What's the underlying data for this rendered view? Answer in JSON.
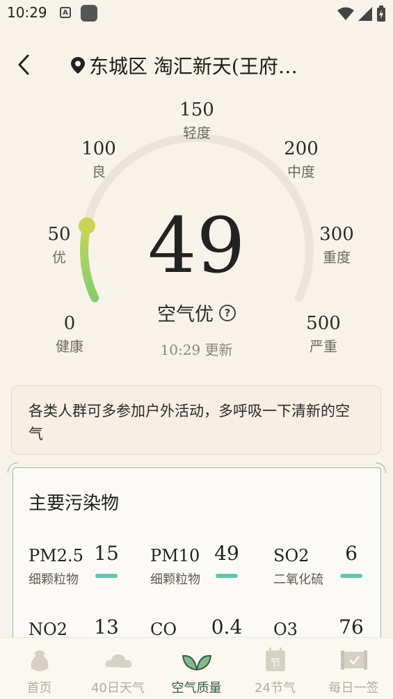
{
  "status_bar": {
    "time": "10:29",
    "notif_a": "A"
  },
  "header": {
    "location": "东城区 淘汇新天(王府…"
  },
  "gauge": {
    "value": 49,
    "value_text": "49",
    "level": "空气优",
    "help": "?",
    "update": "10:29 更新",
    "max": 500,
    "ticks": [
      {
        "num": "0",
        "label": "健康"
      },
      {
        "num": "50",
        "label": "优"
      },
      {
        "num": "100",
        "label": "良"
      },
      {
        "num": "150",
        "label": "轻度"
      },
      {
        "num": "200",
        "label": "中度"
      },
      {
        "num": "300",
        "label": "重度"
      },
      {
        "num": "500",
        "label": "严重"
      }
    ],
    "colors": {
      "track": "#e9e5da",
      "start": "#86cd6a",
      "end": "#c6d45a"
    }
  },
  "advice": {
    "text": "各类人群可多参加户外活动，多呼吸一下清新的空气"
  },
  "pollutants": {
    "title": "主要污染物",
    "items": [
      {
        "name": "PM2.5",
        "desc": "细颗粒物",
        "value": "15"
      },
      {
        "name": "PM10",
        "desc": "细颗粒物",
        "value": "49"
      },
      {
        "name": "SO2",
        "desc": "二氧化硫",
        "value": "6"
      },
      {
        "name": "NO2",
        "desc": "",
        "value": "13"
      },
      {
        "name": "CO",
        "desc": "",
        "value": "0.4"
      },
      {
        "name": "O3",
        "desc": "",
        "value": "76"
      }
    ],
    "bar_color": "#63c5ad"
  },
  "nav": {
    "items": [
      {
        "label": "首页"
      },
      {
        "label": "40日天气"
      },
      {
        "label": "空气质量"
      },
      {
        "label": "24节气"
      },
      {
        "label": "每日一签"
      }
    ],
    "jieqi_icon_text": "节",
    "active_color": "#3a5a45"
  }
}
